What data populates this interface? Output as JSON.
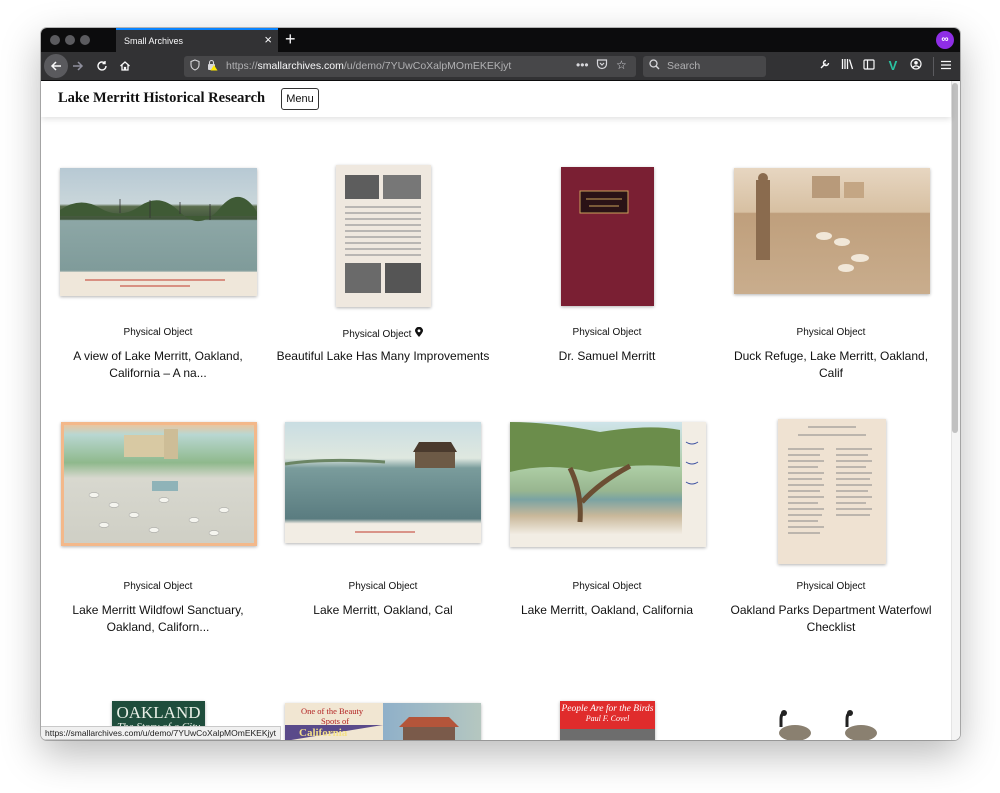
{
  "browser": {
    "tab_title": "Small Archives",
    "close_glyph": "×",
    "newtab_glyph": "+",
    "url_scheme": "https://",
    "url_host": "smallarchives.com",
    "url_path": "/u/demo/7YUwCoXalpMOmEKEKjyt",
    "search_placeholder": "Search",
    "status_url": "https://smallarchives.com/u/demo/7YUwCoXalpMOmEKEKjyt",
    "colors": {
      "tab_accent": "#0a84ff",
      "chrome_dark": "#0c0c0d",
      "toolbar": "#323234",
      "private_badge": "#8f2ee6"
    }
  },
  "site": {
    "title": "Lake Merritt Historical Research",
    "menu_label": "Menu"
  },
  "items": [
    {
      "kind": "Physical Object",
      "title": "A view of Lake Merritt, Oakland, California – A na...",
      "has_location": false
    },
    {
      "kind": "Physical Object",
      "title": "Beautiful Lake Has Many Improvements",
      "has_location": true
    },
    {
      "kind": "Physical Object",
      "title": "Dr. Samuel Merritt",
      "has_location": false
    },
    {
      "kind": "Physical Object",
      "title": "Duck Refuge, Lake Merritt, Oakland, Calif",
      "has_location": false
    },
    {
      "kind": "Physical Object",
      "title": "Lake Merritt Wildfowl Sanctuary, Oakland, Californ...",
      "has_location": false
    },
    {
      "kind": "Physical Object",
      "title": "Lake Merritt, Oakland, Cal",
      "has_location": false
    },
    {
      "kind": "Physical Object",
      "title": "Lake Merritt, Oakland, California",
      "has_location": false
    },
    {
      "kind": "Physical Object",
      "title": "Oakland Parks Department Waterfowl Checklist",
      "has_location": false
    }
  ],
  "partial_covers": {
    "oakland_title": "OAKLAND",
    "oakland_subtitle": "The Story of a City",
    "beauty_line": "One of the Beauty",
    "beauty_line2": "Spots of",
    "beauty_pennant": "California",
    "birds_title": "People Are for the Birds",
    "birds_author": "Paul F. Covel"
  }
}
